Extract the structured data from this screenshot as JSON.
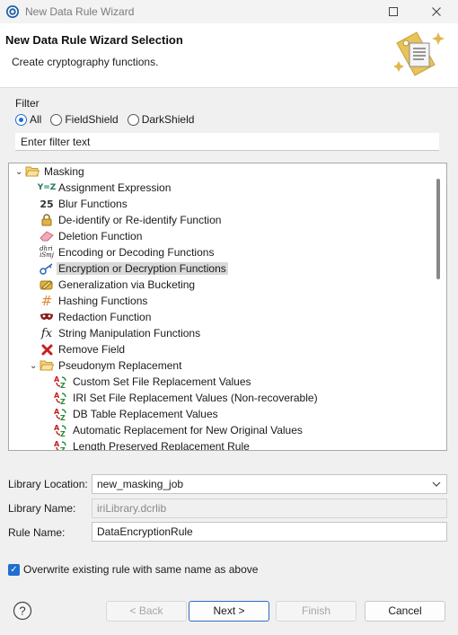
{
  "window": {
    "title": "New Data Rule Wizard"
  },
  "header": {
    "title": "New Data Rule Wizard Selection",
    "subtitle": "Create cryptography functions."
  },
  "filter": {
    "label": "Filter",
    "options": [
      "All",
      "FieldShield",
      "DarkShield"
    ],
    "selected": "All",
    "input_value": "Enter filter text"
  },
  "tree": {
    "items": [
      {
        "label": "Masking",
        "icon": "folder-open-icon",
        "depth": 0,
        "expanded": true
      },
      {
        "label": "Assignment Expression",
        "icon": "assignment-icon",
        "depth": 1
      },
      {
        "label": "Blur Functions",
        "icon": "blur-icon",
        "depth": 1
      },
      {
        "label": "De-identify or Re-identify Function",
        "icon": "lock-icon",
        "depth": 1
      },
      {
        "label": "Deletion Function",
        "icon": "eraser-icon",
        "depth": 1
      },
      {
        "label": "Encoding or Decoding Functions",
        "icon": "encoding-icon",
        "depth": 1
      },
      {
        "label": "Encryption or Decryption Functions",
        "icon": "key-icon",
        "depth": 1,
        "selected": true
      },
      {
        "label": "Generalization via Bucketing",
        "icon": "pencil-icon",
        "depth": 1
      },
      {
        "label": "Hashing Functions",
        "icon": "hash-icon",
        "depth": 1
      },
      {
        "label": "Redaction Function",
        "icon": "mask-icon",
        "depth": 1
      },
      {
        "label": "String Manipulation Functions",
        "icon": "fx-icon",
        "depth": 1
      },
      {
        "label": "Remove Field",
        "icon": "red-x-icon",
        "depth": 1
      },
      {
        "label": "Pseudonym Replacement",
        "icon": "folder-open-icon",
        "depth": 1,
        "expanded": true
      },
      {
        "label": "Custom Set File Replacement Values",
        "icon": "replace-icon",
        "depth": 2
      },
      {
        "label": "IRI Set File Replacement Values (Non-recoverable)",
        "icon": "replace-icon",
        "depth": 2
      },
      {
        "label": "DB Table Replacement Values",
        "icon": "replace-icon",
        "depth": 2
      },
      {
        "label": "Automatic Replacement for New Original Values",
        "icon": "replace-icon",
        "depth": 2
      },
      {
        "label": "Length Preserved Replacement Rule",
        "icon": "replace-icon",
        "depth": 2
      }
    ]
  },
  "form": {
    "library_location_label": "Library Location:",
    "library_location_value": "new_masking_job",
    "library_name_label": "Library Name:",
    "library_name_value": "iriLibrary.dcrlib",
    "rule_name_label": "Rule Name:",
    "rule_name_value": "DataEncryptionRule"
  },
  "overwrite": {
    "label": "Overwrite existing rule with same name as above",
    "checked": true
  },
  "buttons": {
    "back": "< Back",
    "next": "Next >",
    "finish": "Finish",
    "cancel": "Cancel"
  }
}
